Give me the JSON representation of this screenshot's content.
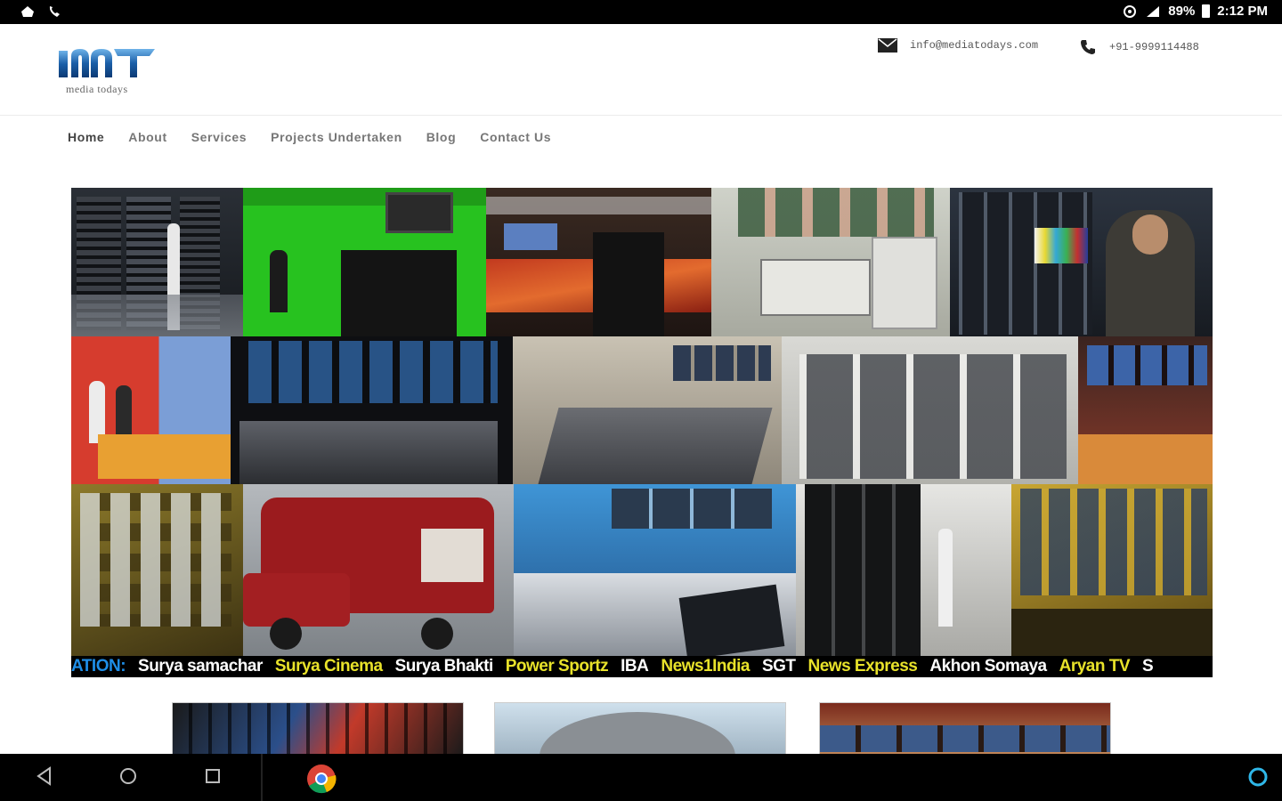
{
  "status_bar": {
    "battery": "89%",
    "time": "2:12 PM"
  },
  "header": {
    "logo_tagline": "media todays",
    "email": "info@mediatodays.com",
    "phone": "+91-9999114488"
  },
  "nav": {
    "items": [
      {
        "label": "Home"
      },
      {
        "label": "About"
      },
      {
        "label": "Services"
      },
      {
        "label": "Projects Undertaken"
      },
      {
        "label": "Blog"
      },
      {
        "label": "Contact Us"
      }
    ]
  },
  "ticker": {
    "items": [
      {
        "text": "ATION:",
        "color": "#1e8ee8"
      },
      {
        "text": "Surya samachar",
        "color": "#ffffff"
      },
      {
        "text": "Surya Cinema",
        "color": "#e8e22a"
      },
      {
        "text": "Surya Bhakti",
        "color": "#ffffff"
      },
      {
        "text": "Power Sportz",
        "color": "#e8e22a"
      },
      {
        "text": "IBA",
        "color": "#ffffff"
      },
      {
        "text": "News1India",
        "color": "#e8e22a"
      },
      {
        "text": "SGT",
        "color": "#ffffff"
      },
      {
        "text": "News Express",
        "color": "#e8e22a"
      },
      {
        "text": "Akhon Somaya",
        "color": "#ffffff"
      },
      {
        "text": "Aryan TV",
        "color": "#e8e22a"
      },
      {
        "text": "S",
        "color": "#ffffff"
      }
    ]
  },
  "colors": {
    "ticker_blue": "#1e8ee8",
    "ticker_yellow": "#e8e22a",
    "green_screen": "#27c21f",
    "van_red": "#9b1b1e"
  }
}
